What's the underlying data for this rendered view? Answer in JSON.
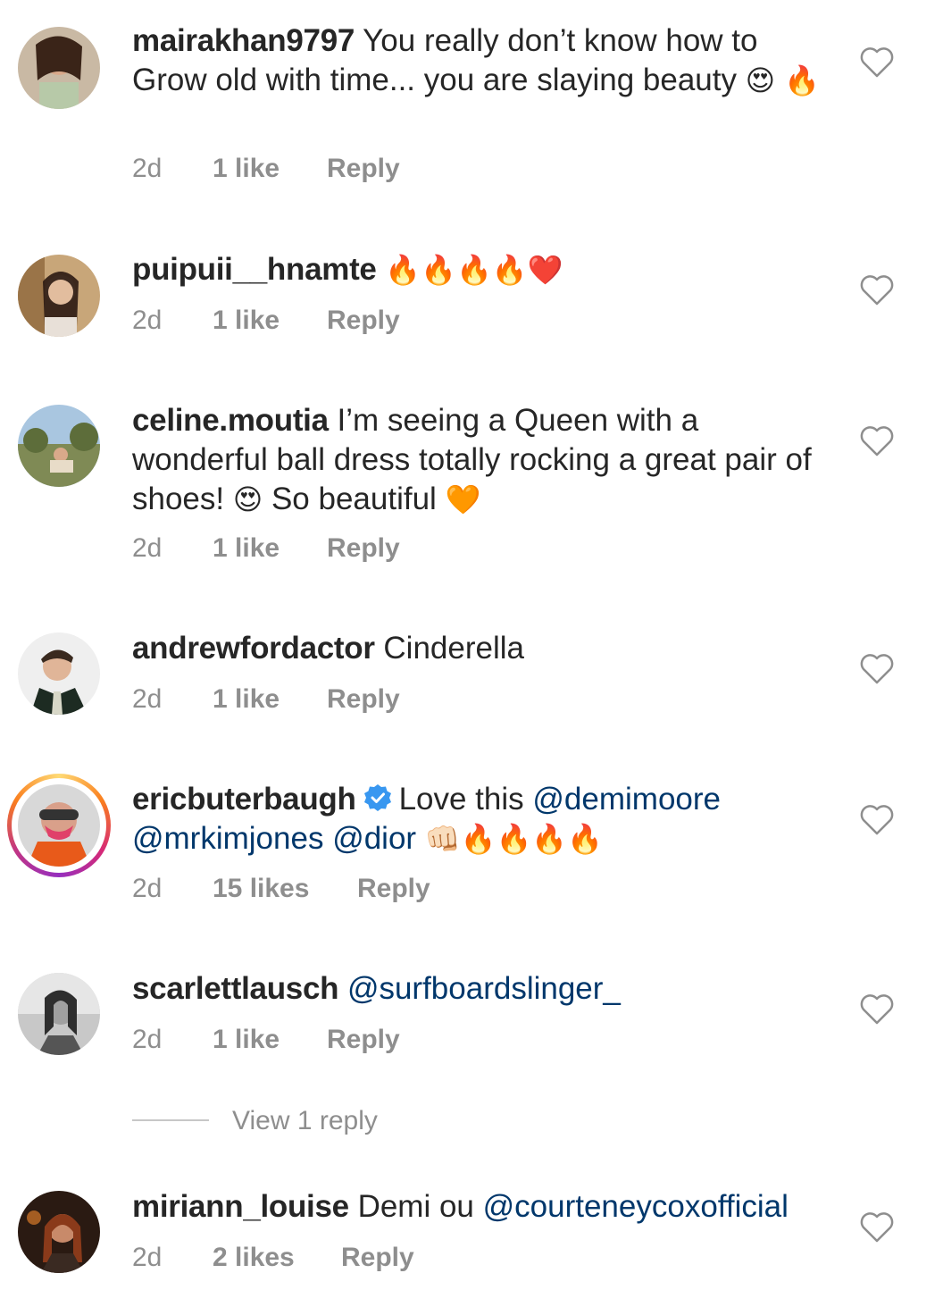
{
  "comments": [
    {
      "username": "mairakhan9797",
      "text": "You really don’t know how to Grow old with time... you are slaying beauty",
      "emoji": "😍 🔥",
      "time": "2d",
      "likes": "1 like",
      "reply": "Reply"
    },
    {
      "username": "puipuii__hnamte",
      "text": "",
      "emoji": "🔥🔥🔥🔥❤️",
      "time": "2d",
      "likes": "1 like",
      "reply": "Reply"
    },
    {
      "username": "celine.moutia",
      "text": "I’m seeing a Queen with a wonderful ball dress totally rocking a great pair of shoes!",
      "emoji1": "😍",
      "text2": "So beautiful",
      "emoji2": "🧡",
      "time": "2d",
      "likes": "1 like",
      "reply": "Reply"
    },
    {
      "username": "andrewfordactor",
      "text": "Cinderella",
      "time": "2d",
      "likes": "1 like",
      "reply": "Reply"
    },
    {
      "username": "ericbuterbaugh",
      "text": "Love this",
      "mentions": [
        "@demimoore",
        "@mrkimjones",
        "@dior"
      ],
      "emoji": "👊🏻🔥🔥🔥🔥",
      "time": "2d",
      "likes": "15 likes",
      "reply": "Reply"
    },
    {
      "username": "scarlettlausch",
      "mention": "@surfboardslinger_",
      "time": "2d",
      "likes": "1 like",
      "reply": "Reply"
    },
    {
      "username": "miriann_louise",
      "text": "Demi ou",
      "mention": "@courteneycoxofficial",
      "time": "2d",
      "likes": "2 likes",
      "reply": "Reply"
    }
  ],
  "view_replies": "View 1 reply",
  "icons": {
    "like": "heart-outline-icon",
    "verified": "verified-badge-icon"
  },
  "colors": {
    "text": "#262626",
    "meta": "#8e8e8e",
    "mention": "#00376b",
    "verified": "#3897f0"
  }
}
